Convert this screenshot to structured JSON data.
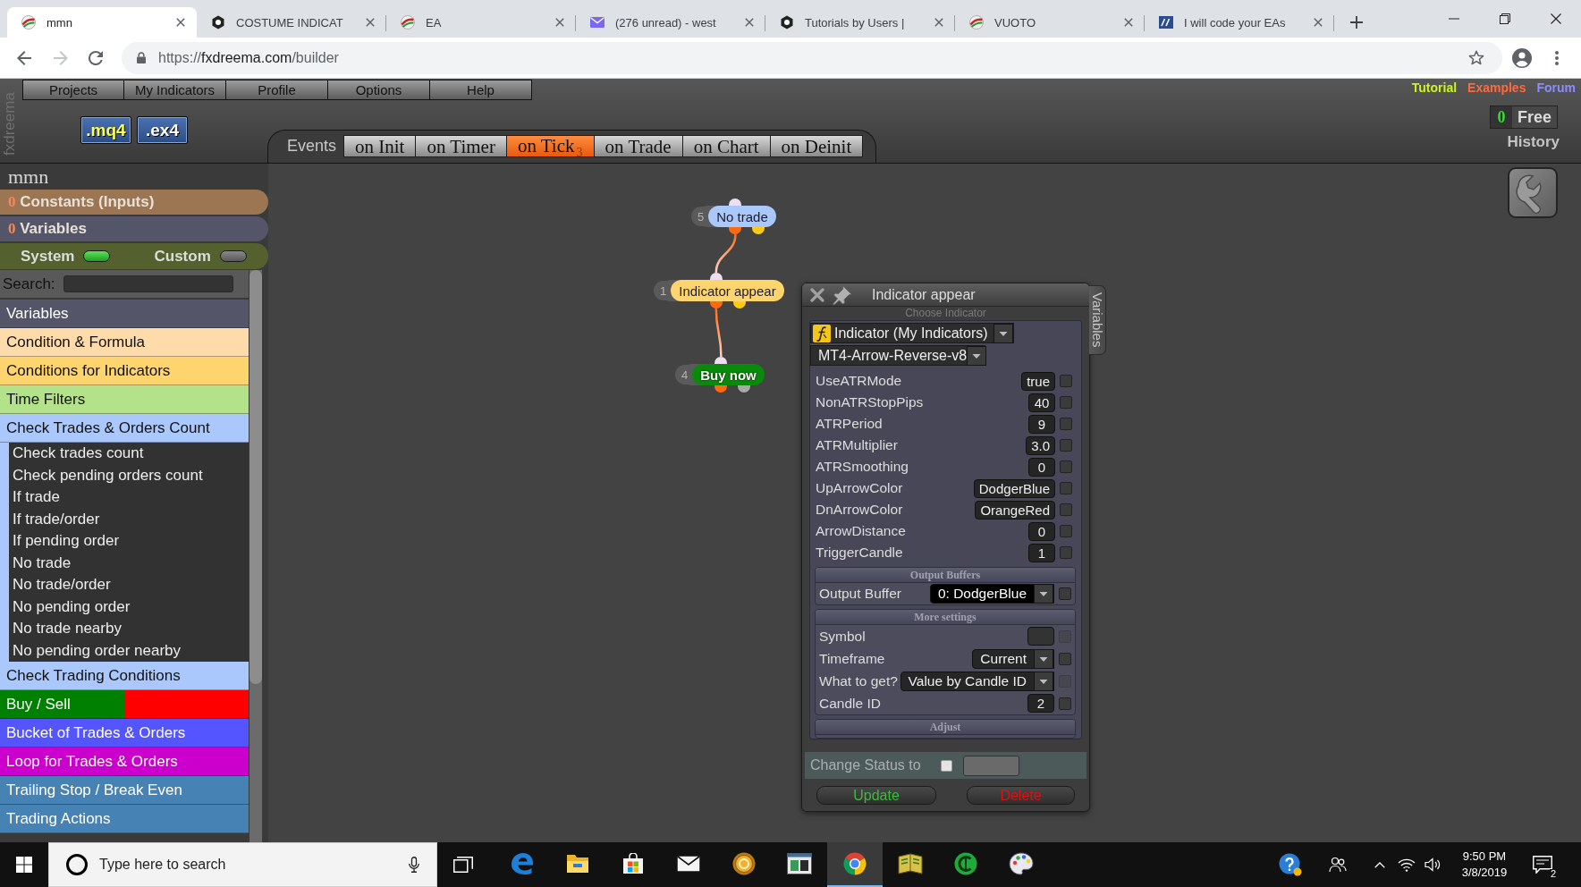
{
  "browser": {
    "tabs": [
      {
        "title": "mmn",
        "selected": true
      },
      {
        "title": "COSTUME INDICAT",
        "selected": false
      },
      {
        "title": "EA",
        "selected": false
      },
      {
        "title": "(276 unread) - west",
        "selected": false
      },
      {
        "title": "Tutorials by Users |",
        "selected": false
      },
      {
        "title": "VUOTO",
        "selected": false
      },
      {
        "title": "I will code your EAs",
        "selected": false
      }
    ],
    "nav": [
      {
        "kind": "back",
        "disabled": false
      },
      {
        "kind": "forward",
        "disabled": true
      },
      {
        "kind": "reload",
        "disabled": false
      }
    ],
    "url": {
      "scheme": "https://",
      "host": "fxdreema.com",
      "path": "/builder"
    }
  },
  "app": {
    "brand": "fxdreema",
    "menu": [
      "Projects",
      "My Indicators",
      "Profile",
      "Options",
      "Help"
    ],
    "exports": [
      {
        "label": ".mq4",
        "color": "#ffff4d"
      },
      {
        "label": ".ex4",
        "color": "#ffffff"
      }
    ],
    "events": {
      "label": "Events",
      "tabs": [
        {
          "label": "on Init",
          "selected": false
        },
        {
          "label": "on Timer",
          "selected": false
        },
        {
          "label": "on Tick",
          "count": "3",
          "selected": true
        },
        {
          "label": "on Trade",
          "selected": false
        },
        {
          "label": "on Chart",
          "selected": false
        },
        {
          "label": "on Deinit",
          "selected": false
        }
      ]
    },
    "links": [
      {
        "label": "Tutorial",
        "color": "#c8f51e"
      },
      {
        "label": "Examples",
        "color": "#ff6a3d"
      },
      {
        "label": "Forum",
        "color": "#8c8cff"
      }
    ],
    "counter": {
      "value": "0",
      "label": "Free"
    },
    "history": "History"
  },
  "sidebar": {
    "project": "mmn",
    "sections": [
      {
        "count": "0",
        "label": "Constants (Inputs)",
        "color": "#9c7653"
      },
      {
        "count": "0",
        "label": "Variables",
        "color": "#55556a"
      }
    ],
    "toggles": [
      {
        "label": "System",
        "on": true
      },
      {
        "label": "Custom",
        "on": false
      }
    ],
    "search": {
      "label": "Search:"
    },
    "categories": [
      {
        "label": "Variables",
        "color": "#55556a"
      },
      {
        "label": "Condition & Formula",
        "color": "#fedbab"
      },
      {
        "label": "Conditions for Indicators",
        "color": "#fed46e"
      },
      {
        "label": "Time Filters",
        "color": "#b4e28a"
      },
      {
        "label": "Check Trades & Orders Count",
        "color": "#aac8fb",
        "expanded": true,
        "children": [
          {
            "label": "Check trades count"
          },
          {
            "label": "Check pending orders count"
          },
          {
            "label": "If trade"
          },
          {
            "label": "If trade/order"
          },
          {
            "label": "If pending order"
          },
          {
            "label": "No trade"
          },
          {
            "label": "No trade/order"
          },
          {
            "label": "No pending order"
          },
          {
            "label": "No trade nearby"
          },
          {
            "label": "No pending order nearby"
          }
        ]
      },
      {
        "label": "Check Trading Conditions",
        "color": "#aac8fb"
      },
      {
        "label": "Buy / Sell",
        "color": "#008000",
        "right_half": {
          "color": "#ff0000"
        }
      },
      {
        "label": "Bucket of Trades & Orders",
        "color": "#5555ff"
      },
      {
        "label": "Loop for Trades & Orders",
        "color": "#cc00cc"
      },
      {
        "label": "Trailing Stop / Break Even",
        "color": "#4682b4"
      },
      {
        "label": "Trading Actions",
        "color": "#4682b4"
      }
    ]
  },
  "canvas": {
    "nodes": [
      {
        "number": "5",
        "label": "No trade",
        "kind": "condition",
        "color": "#aac8fb",
        "children": [
          {
            "number": "1",
            "label": "Indicator appear",
            "kind": "condition",
            "color": "#fed46e",
            "children": [
              {
                "number": "4",
                "label": "Buy now",
                "kind": "action",
                "color": "#0a8a0a"
              }
            ]
          }
        ]
      }
    ]
  },
  "dialog": {
    "title": "Indicator appear",
    "side_tab": "Variables",
    "caption": "Choose Indicator",
    "indicator_source": "Indicator (My Indicators)",
    "indicator": "MT4-Arrow-Reverse-v8",
    "params": [
      {
        "name": "UseATRMode",
        "value": "true",
        "checked": false
      },
      {
        "name": "NonATRStopPips",
        "value": "40",
        "checked": false
      },
      {
        "name": "ATRPeriod",
        "value": "9",
        "checked": false
      },
      {
        "name": "ATRMultiplier",
        "value": "3.0",
        "checked": false
      },
      {
        "name": "ATRSmoothing",
        "value": "0",
        "checked": false
      },
      {
        "name": "UpArrowColor",
        "value": "DodgerBlue",
        "checked": false
      },
      {
        "name": "DnArrowColor",
        "value": "OrangeRed",
        "checked": false
      },
      {
        "name": "ArrowDistance",
        "value": "0",
        "checked": false
      },
      {
        "name": "TriggerCandle",
        "value": "1",
        "checked": false
      }
    ],
    "output": {
      "header": "Output Buffers",
      "label": "Output Buffer",
      "value": "0: DodgerBlue",
      "checked": false
    },
    "more": {
      "header": "More settings",
      "rows": [
        {
          "kind": "text",
          "name": "Symbol",
          "checked": false,
          "disabled": true
        },
        {
          "kind": "select",
          "name": "Timeframe",
          "value": "Current",
          "checked": false,
          "disabled": false
        },
        {
          "kind": "select",
          "name": "What to get?",
          "value": "Value by Candle ID",
          "checked": false,
          "disabled": true
        },
        {
          "kind": "number",
          "name": "Candle ID",
          "value": "2",
          "checked": false,
          "disabled": false
        }
      ]
    },
    "adjust": "Adjust",
    "status": {
      "label": "Change Status to",
      "checked": false
    },
    "buttons": [
      {
        "label": "Update",
        "kind": "update"
      },
      {
        "label": "Delete",
        "kind": "delete"
      }
    ]
  },
  "taskbar": {
    "search": {
      "placeholder": "Type here to search"
    },
    "apps": [
      {
        "active": false
      },
      {
        "active": false
      },
      {
        "active": false
      },
      {
        "active": false
      },
      {
        "active": false
      },
      {
        "active": false
      },
      {
        "active": true
      },
      {
        "active": false
      },
      {
        "active": false
      },
      {
        "active": false
      }
    ],
    "clock": {
      "time": "9:50 PM",
      "date": "3/8/2019"
    },
    "notifications": "2"
  }
}
